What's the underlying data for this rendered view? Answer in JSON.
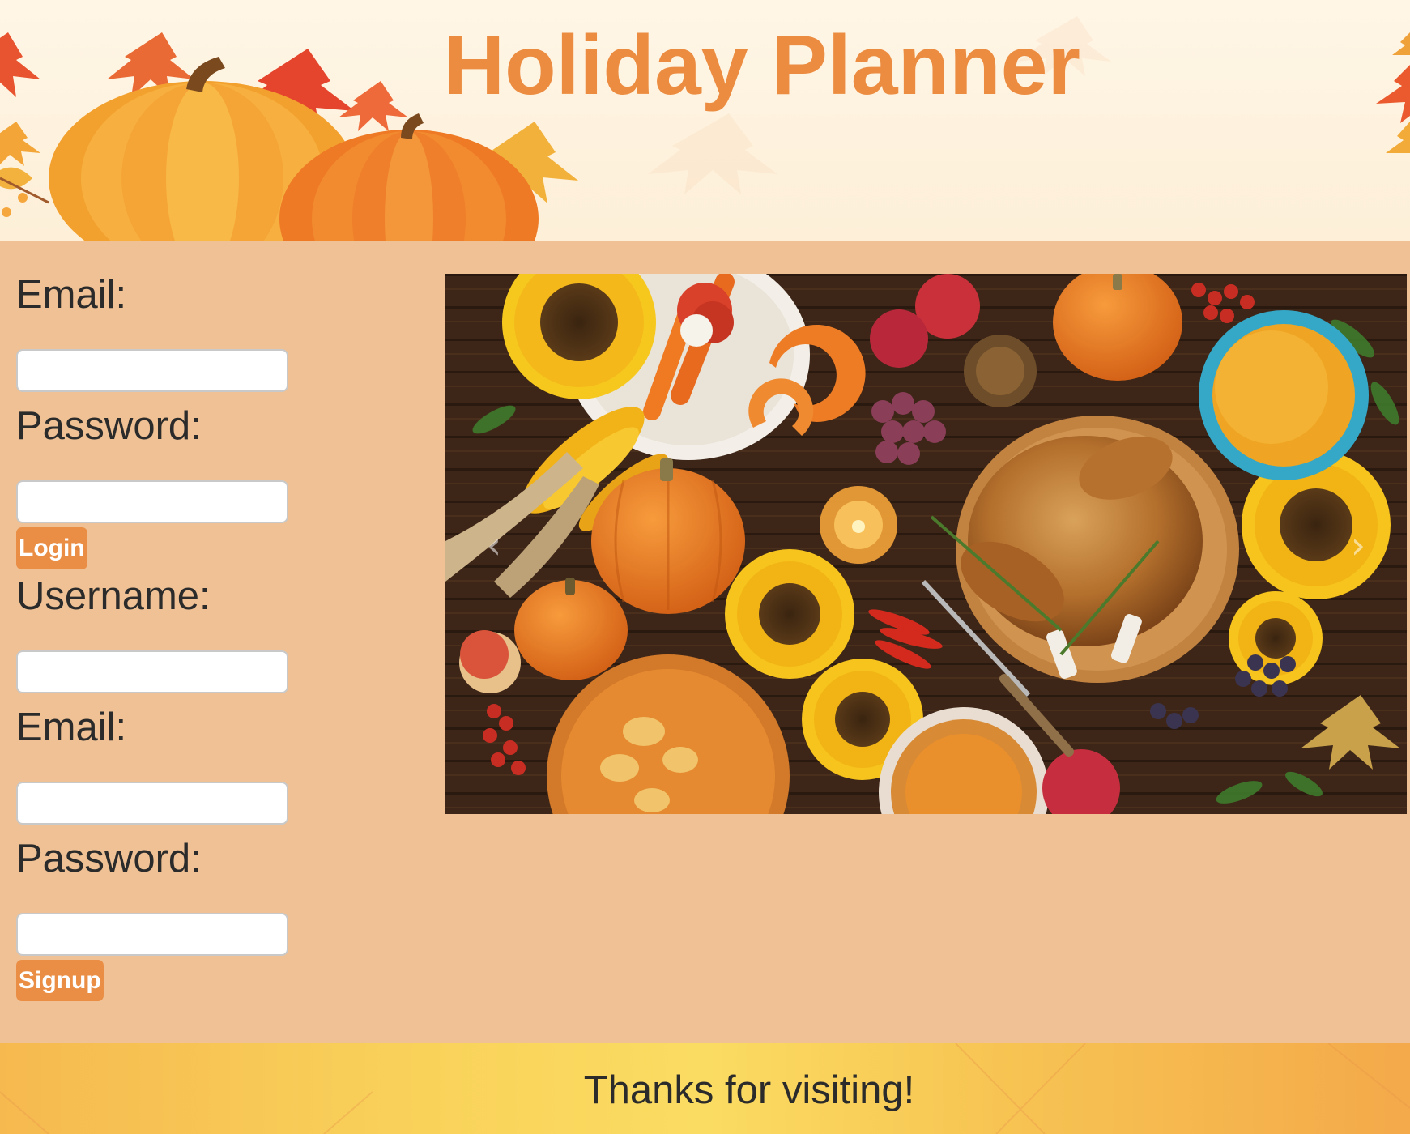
{
  "header": {
    "title": "Holiday Planner",
    "title_color": "#ec8c40"
  },
  "login_form": {
    "email_label": "Email:",
    "email_value": "",
    "password_label": "Password:",
    "password_value": "",
    "submit_label": "Login"
  },
  "signup_form": {
    "username_label": "Username:",
    "username_value": "",
    "email_label": "Email:",
    "email_value": "",
    "password_label": "Password:",
    "password_value": "",
    "submit_label": "Signup"
  },
  "carousel": {
    "image_subject": "thanksgiving-feast-table",
    "prev_icon": "chevron-left-icon",
    "next_icon": "chevron-right-icon"
  },
  "footer": {
    "text": "Thanks for visiting!"
  },
  "colors": {
    "page_background": "#efc194",
    "accent": "#ea8e45",
    "text": "#2b2b2b"
  }
}
